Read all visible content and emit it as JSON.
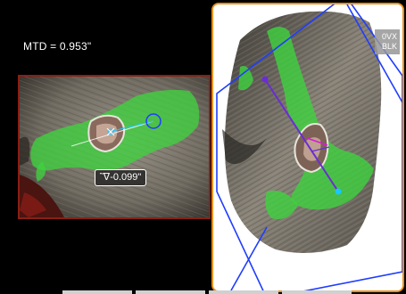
{
  "left_view": {
    "mtd_text": "MTD = 0.953\"",
    "depth_text": "-0.099\""
  },
  "right_view": {
    "badge_line1": "0VX",
    "badge_line2": "BLK"
  },
  "colors": {
    "left_frame": "#8a1f14",
    "right_frame": "#e8901c",
    "mask_green": "#3fd23f",
    "plane_blue": "#1f3dff",
    "cursor_cyan": "#19c7ff",
    "line_purple": "#6b2cd6",
    "magenta": "#d81bd8"
  },
  "icons": [
    "profile-icon"
  ]
}
